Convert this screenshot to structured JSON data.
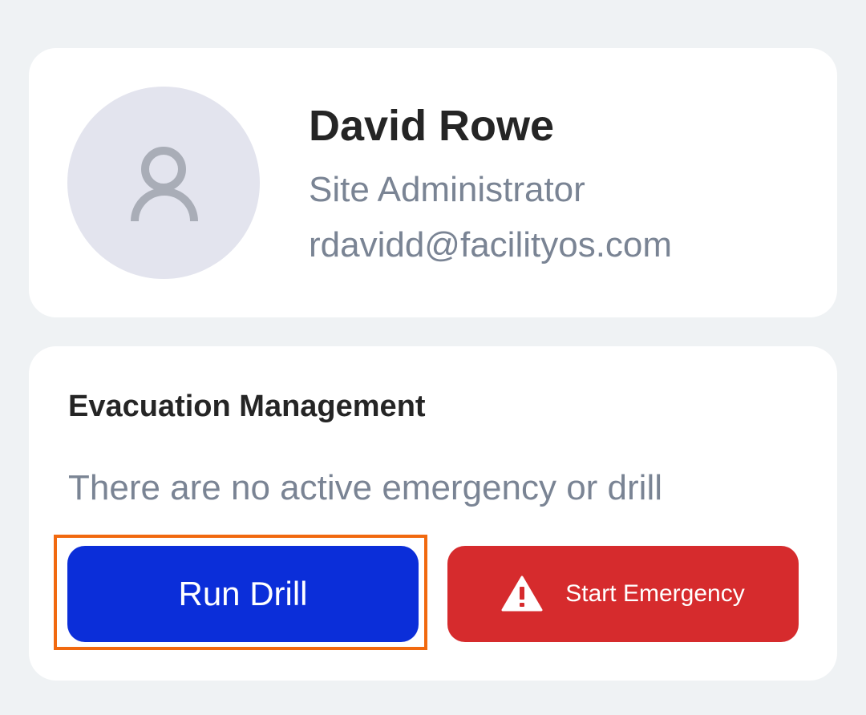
{
  "profile": {
    "name": "David Rowe",
    "role": "Site Administrator",
    "email": "rdavidd@facilityos.com",
    "avatar_icon": "person-icon"
  },
  "evacuation": {
    "title": "Evacuation Management",
    "status": "There are no active emergency or drill",
    "run_drill_label": "Run Drill",
    "start_emergency_label": "Start Emergency",
    "warning_icon": "warning-triangle-icon"
  },
  "colors": {
    "background": "#eff2f4",
    "card": "#ffffff",
    "drill_button": "#0b2ed9",
    "emergency_button": "#d62b2d",
    "focus_outline": "#f1690f",
    "muted_text": "#7a8494"
  }
}
